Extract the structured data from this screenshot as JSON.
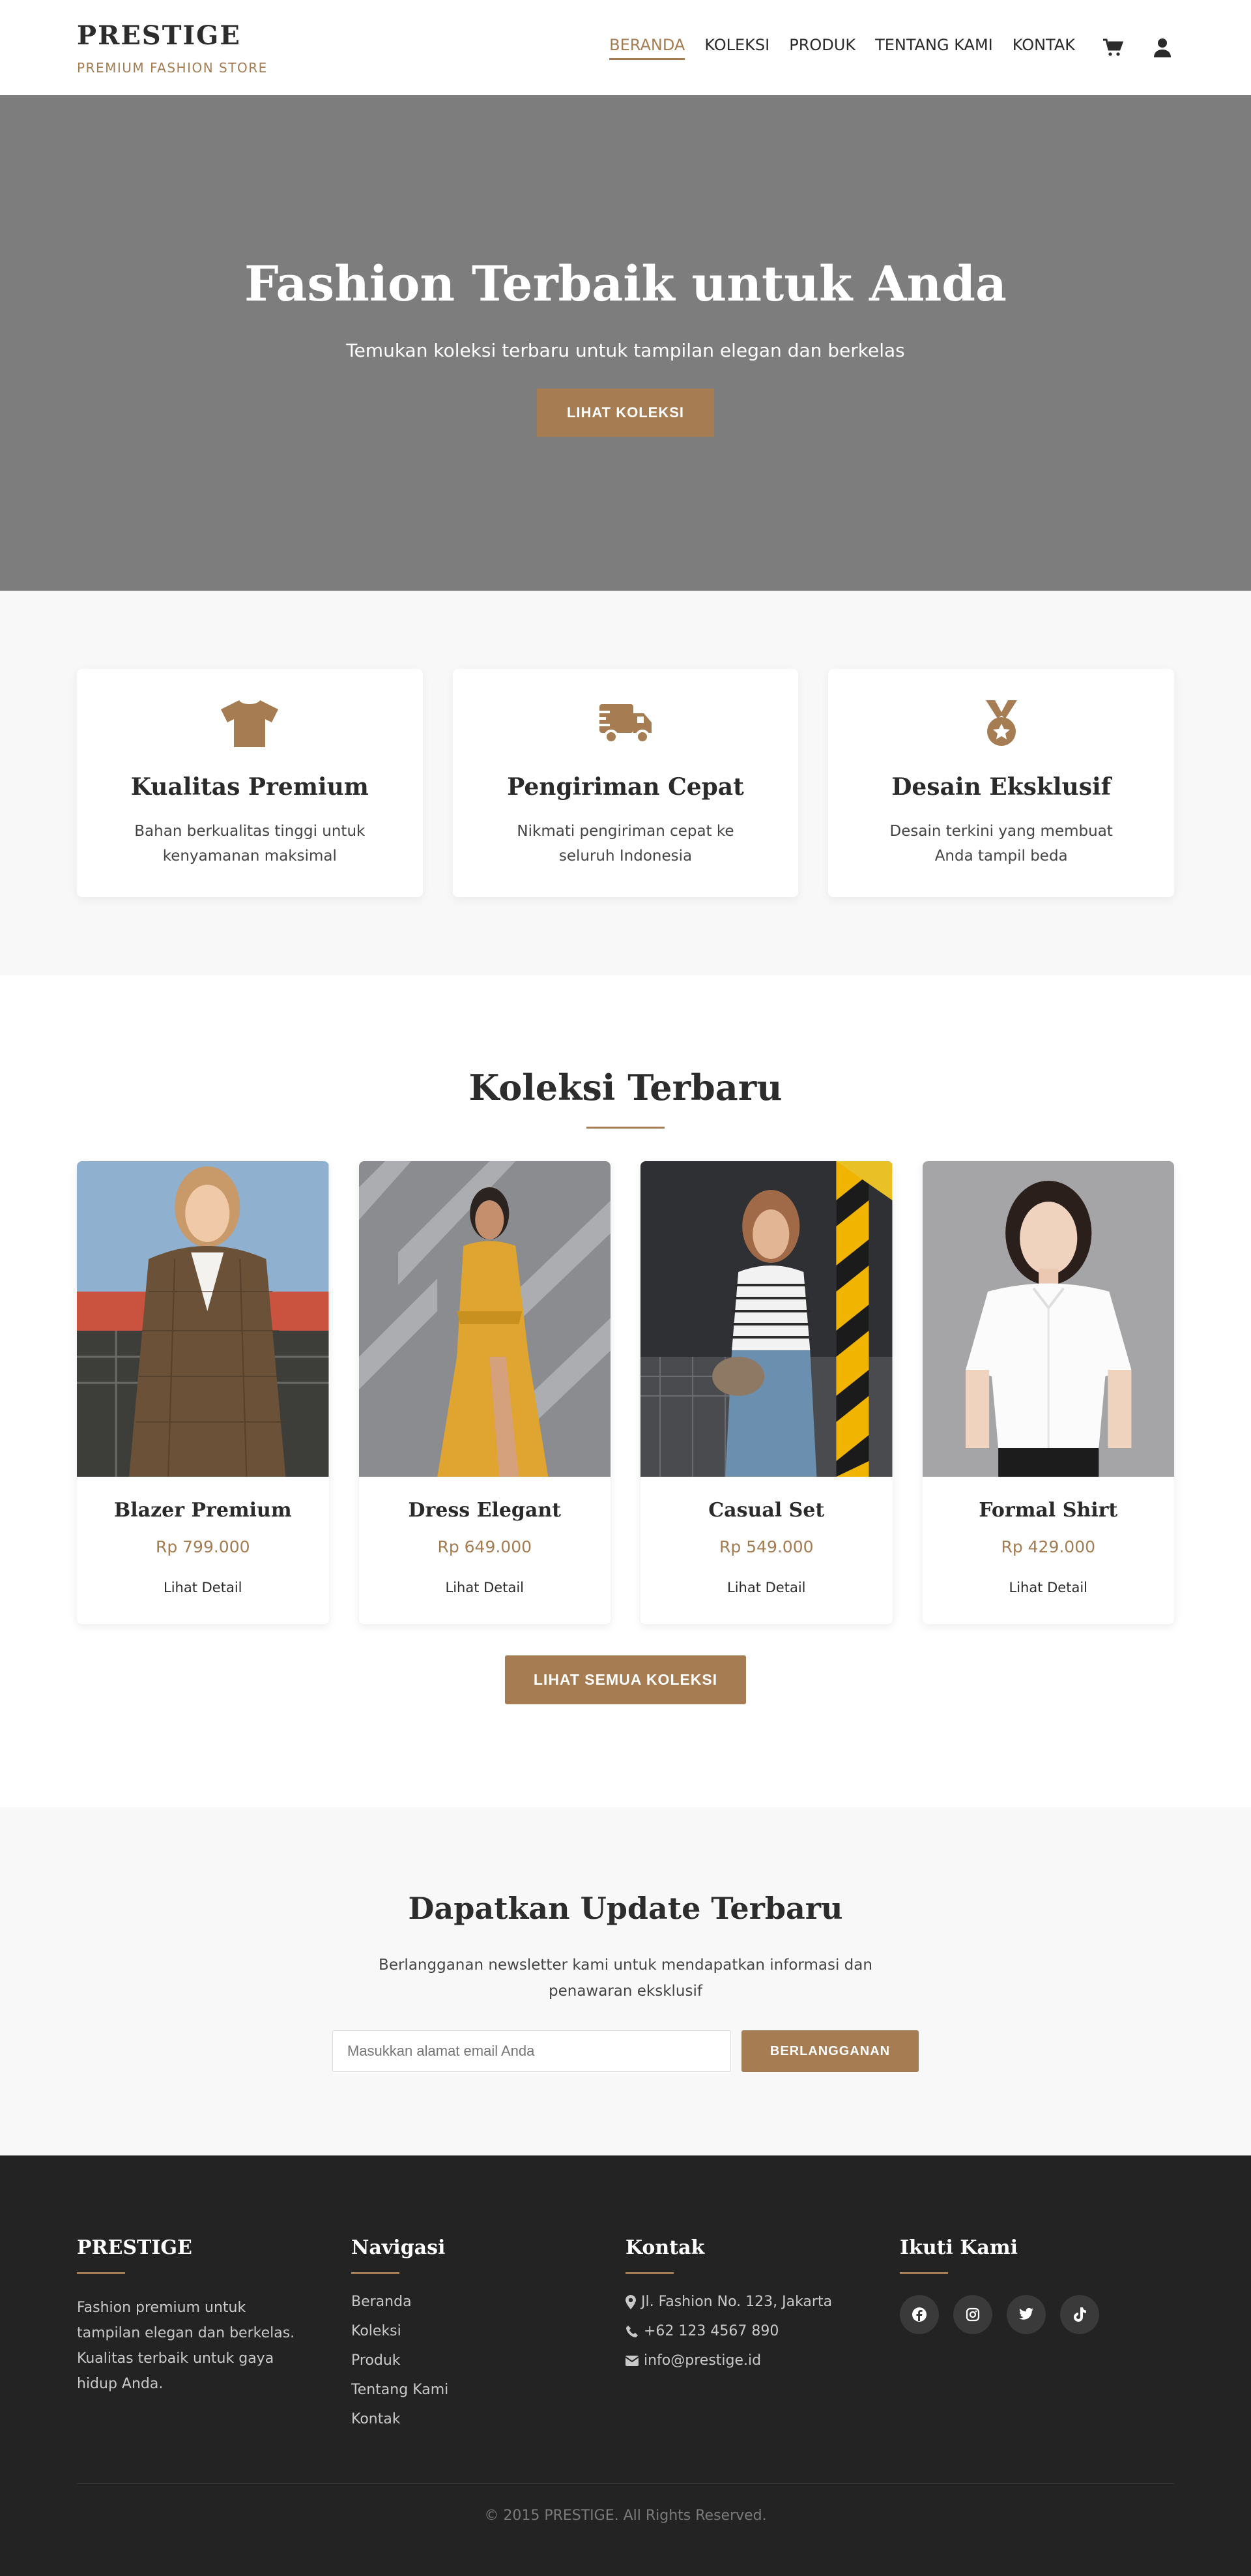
{
  "header": {
    "brand": "PRESTIGE",
    "tagline": "PREMIUM FASHION STORE",
    "nav": [
      {
        "label": "BERANDA",
        "active": true
      },
      {
        "label": "KOLEKSI"
      },
      {
        "label": "PRODUK"
      },
      {
        "label": "TENTANG KAMI"
      },
      {
        "label": "KONTAK"
      }
    ],
    "icons": [
      "cart-icon",
      "user-icon"
    ]
  },
  "hero": {
    "title": "Fashion Terbaik untuk Anda",
    "subtitle": "Temukan koleksi terbaru untuk tampilan elegan dan berkelas",
    "cta": "LIHAT KOLEKSI",
    "background_color": "#7d7d7d"
  },
  "features": [
    {
      "icon": "tshirt-icon",
      "title": "Kualitas Premium",
      "desc": "Bahan berkualitas tinggi untuk kenyamanan maksimal"
    },
    {
      "icon": "truck-icon",
      "title": "Pengiriman Cepat",
      "desc": "Nikmati pengiriman cepat ke seluruh Indonesia"
    },
    {
      "icon": "medal-icon",
      "title": "Desain Eksklusif",
      "desc": "Desain terkini yang membuat Anda tampil beda"
    }
  ],
  "collection": {
    "title": "Koleksi Terbaru",
    "products": [
      {
        "name": "Blazer Premium",
        "price": "Rp 799.000",
        "link": "Lihat Detail"
      },
      {
        "name": "Dress Elegant",
        "price": "Rp 649.000",
        "link": "Lihat Detail"
      },
      {
        "name": "Casual Set",
        "price": "Rp 549.000",
        "link": "Lihat Detail"
      },
      {
        "name": "Formal Shirt",
        "price": "Rp 429.000",
        "link": "Lihat Detail"
      }
    ],
    "cta": "LIHAT SEMUA KOLEKSI"
  },
  "newsletter": {
    "title": "Dapatkan Update Terbaru",
    "desc": "Berlangganan newsletter kami untuk mendapatkan informasi dan penawaran eksklusif",
    "placeholder": "Masukkan alamat email Anda",
    "button": "BERLANGGANAN"
  },
  "footer": {
    "brand": "PRESTIGE",
    "about": "Fashion premium untuk tampilan elegan dan berkelas. Kualitas terbaik untuk gaya hidup Anda.",
    "nav_heading": "Navigasi",
    "nav": [
      "Beranda",
      "Koleksi",
      "Produk",
      "Tentang Kami",
      "Kontak"
    ],
    "contact_heading": "Kontak",
    "contact": {
      "address": "Jl. Fashion No. 123, Jakarta",
      "phone": "+62 123 4567 890",
      "email": "info@prestige.id"
    },
    "social_heading": "Ikuti Kami",
    "social": [
      "facebook-icon",
      "instagram-icon",
      "twitter-icon",
      "tiktok-icon"
    ],
    "copyright": "© 2015 PRESTIGE. All Rights Reserved."
  },
  "colors": {
    "accent": "#a67c52",
    "dark": "#232323",
    "light_bg": "#f8f8f8"
  }
}
